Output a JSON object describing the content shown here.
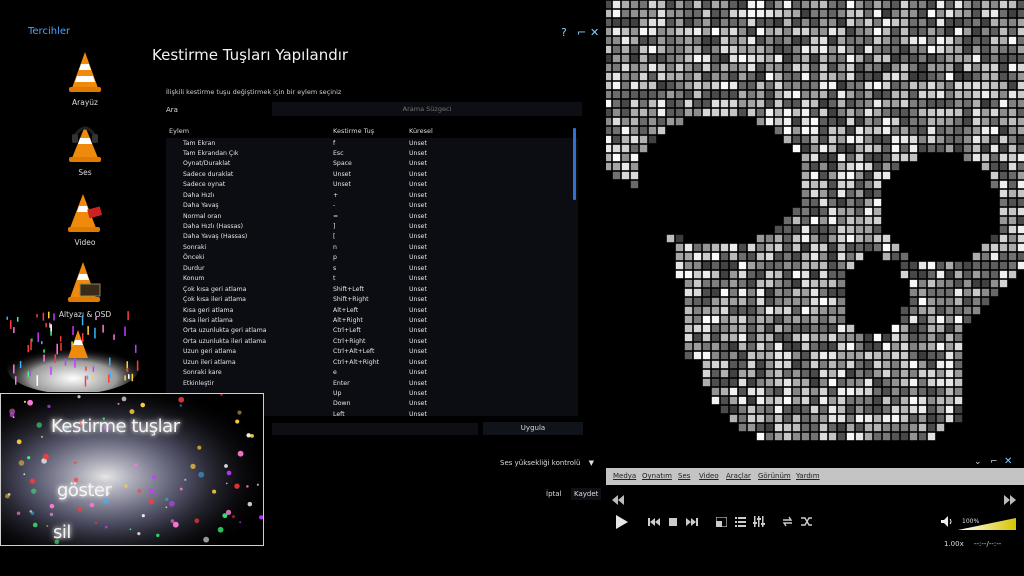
{
  "prefs": {
    "title": "Tercihler",
    "help": "?",
    "close": "✕"
  },
  "sidebar": {
    "items": [
      {
        "label": "Arayüz"
      },
      {
        "label": "Ses"
      },
      {
        "label": "Video"
      },
      {
        "label": "Altyazı & OSD"
      }
    ]
  },
  "main": {
    "heading": "Kestirme Tuşları Yapılandır",
    "hint": "İlişkili kestirme tuşu değiştirmek için bir eylem seçiniz",
    "search_label": "Ara",
    "search_placeholder": "Arama Süzgeci",
    "columns": [
      "Eylem",
      "Kestirme Tuş",
      "Küresel"
    ],
    "rows": [
      [
        "Tam Ekran",
        "f",
        "Unset"
      ],
      [
        "Tam Ekrandan Çık",
        "Esc",
        "Unset"
      ],
      [
        "Oynat/Duraklat",
        "Space",
        "Unset"
      ],
      [
        "Sadece duraklat",
        "Unset",
        "Unset"
      ],
      [
        "Sadece oynat",
        "Unset",
        "Unset"
      ],
      [
        "Daha Hızlı",
        "+",
        "Unset"
      ],
      [
        "Daha Yavaş",
        "-",
        "Unset"
      ],
      [
        "Normal oran",
        "=",
        "Unset"
      ],
      [
        "Daha Hızlı (Hassas)",
        "]",
        "Unset"
      ],
      [
        "Daha Yavaş (Hassas)",
        "[",
        "Unset"
      ],
      [
        "Sonraki",
        "n",
        "Unset"
      ],
      [
        "Önceki",
        "p",
        "Unset"
      ],
      [
        "Durdur",
        "s",
        "Unset"
      ],
      [
        "Konum",
        "t",
        "Unset"
      ],
      [
        "Çok kısa geri atlama",
        "Shift+Left",
        "Unset"
      ],
      [
        "Çok kısa ileri atlama",
        "Shift+Right",
        "Unset"
      ],
      [
        "Kısa geri atlama",
        "Alt+Left",
        "Unset"
      ],
      [
        "Kısa ileri atlama",
        "Alt+Right",
        "Unset"
      ],
      [
        "Orta uzunlukta geri atlama",
        "Ctrl+Left",
        "Unset"
      ],
      [
        "Orta uzunlukta ileri atlama",
        "Ctrl+Right",
        "Unset"
      ],
      [
        "Uzun geri atlama",
        "Ctrl+Alt+Left",
        "Unset"
      ],
      [
        "Uzun ileri atlama",
        "Ctrl+Alt+Right",
        "Unset"
      ],
      [
        "Sonraki kare",
        "e",
        "Unset"
      ],
      [
        "Etkinleştir",
        "Enter",
        "Unset"
      ],
      [
        "",
        "Up",
        "Unset"
      ],
      [
        "",
        "Down",
        "Unset"
      ],
      [
        "",
        "Left",
        "Unset"
      ]
    ],
    "apply_label": "Uygula",
    "volume_control_label": "Ses yüksekliği kontrolü",
    "volume_control_arrow": "▼",
    "cancel_label": "İptal",
    "save_label": "Kaydet"
  },
  "preview": {
    "line1": "Kestirme tuşlar",
    "line2": "göster",
    "line3": "sil"
  },
  "player": {
    "menus": [
      "Medya",
      "Oynatım",
      "Ses",
      "Video",
      "Araçlar",
      "Görünüm",
      "Yardım"
    ],
    "volume_percent": "100%",
    "volume_level": 1.0,
    "speed": "1.00x",
    "time": "--:--/--:--"
  },
  "colors": {
    "accent": "#4aa3ff",
    "scrollbar": "#2f6fd6",
    "menubar": "#c4c4c4",
    "vlc_orange": "#f08a0c",
    "volume_gradient_start": "#ffffff",
    "volume_gradient_end": "#d6c400"
  }
}
